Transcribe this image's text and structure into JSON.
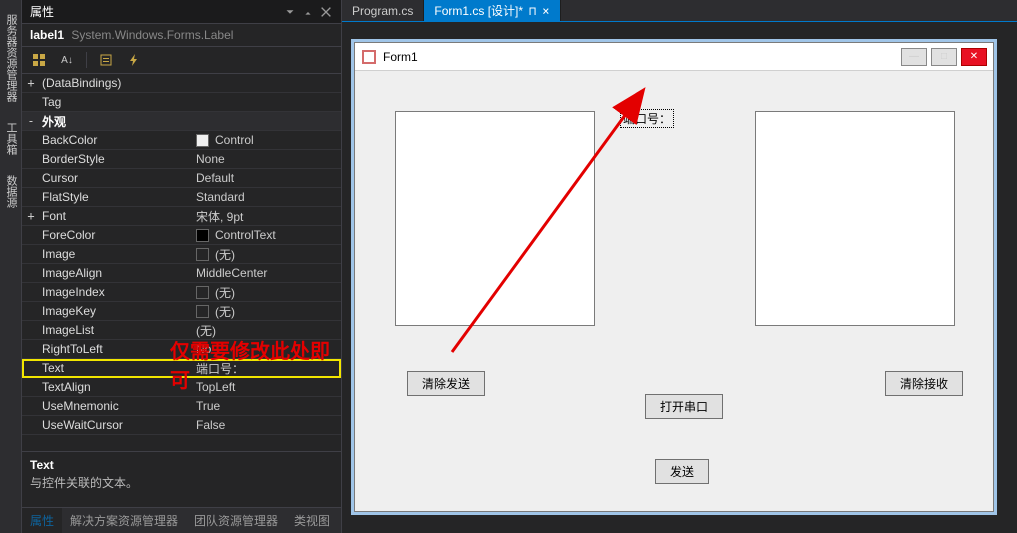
{
  "side_tabs": [
    "服务器资源管理器",
    "工具箱",
    "数据源"
  ],
  "props": {
    "panel_title": "属性",
    "object_name": "label1",
    "object_type": "System.Windows.Forms.Label",
    "categories": [
      {
        "expander": "+",
        "rows": [
          {
            "key": "(DataBindings)",
            "val": ""
          },
          {
            "key": "Tag",
            "val": ""
          }
        ]
      },
      {
        "expander": "-",
        "name": "外观",
        "rows": [
          {
            "key": "BackColor",
            "val": "Control",
            "swatch": "#f0f0f0"
          },
          {
            "key": "BorderStyle",
            "val": "None"
          },
          {
            "key": "Cursor",
            "val": "Default"
          },
          {
            "key": "FlatStyle",
            "val": "Standard"
          },
          {
            "key": "Font",
            "val": "宋体, 9pt",
            "expander": "+"
          },
          {
            "key": "ForeColor",
            "val": "ControlText",
            "swatch": "#000000"
          },
          {
            "key": "Image",
            "val": "(无)",
            "swatch": ""
          },
          {
            "key": "ImageAlign",
            "val": "MiddleCenter"
          },
          {
            "key": "ImageIndex",
            "val": "(无)",
            "swatch": ""
          },
          {
            "key": "ImageKey",
            "val": "(无)",
            "swatch": ""
          },
          {
            "key": "ImageList",
            "val": "(无)"
          },
          {
            "key": "RightToLeft",
            "val": "No"
          },
          {
            "key": "Text",
            "val": "端口号：",
            "highlight": true
          },
          {
            "key": "TextAlign",
            "val": "TopLeft"
          },
          {
            "key": "UseMnemonic",
            "val": "True"
          },
          {
            "key": "UseWaitCursor",
            "val": "False"
          }
        ]
      }
    ],
    "help_name": "Text",
    "help_desc": "与控件关联的文本。",
    "bottom_tabs": [
      "属性",
      "解决方案资源管理器",
      "团队资源管理器",
      "类视图"
    ],
    "bottom_active": 0
  },
  "doc_tabs": [
    {
      "label": "Program.cs",
      "active": false
    },
    {
      "label": "Form1.cs [设计]*",
      "active": true
    }
  ],
  "form": {
    "title": "Form1",
    "label_text": "端口号：",
    "btn_clear_send": "清除发送",
    "btn_open_port": "打开串口",
    "btn_clear_recv": "清除接收",
    "btn_send": "发送"
  },
  "annotation": "仅需要修改此处即可"
}
